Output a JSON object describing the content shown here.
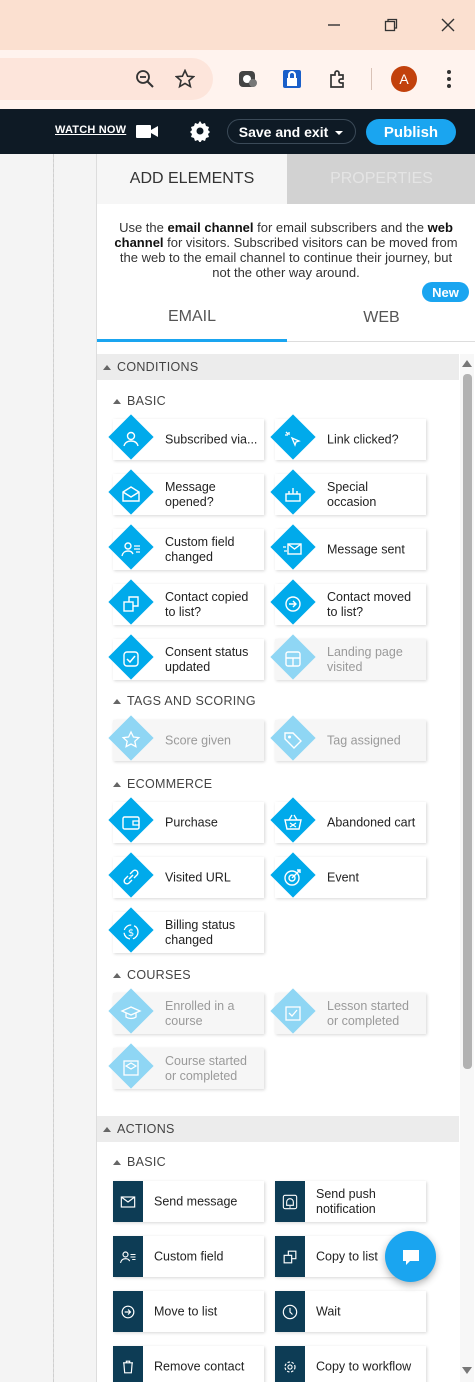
{
  "app_header": {
    "watch_now": "WATCH NOW",
    "save_exit": "Save and exit",
    "publish": "Publish"
  },
  "browser": {
    "avatar_letter": "A"
  },
  "panel": {
    "tab_add": "ADD ELEMENTS",
    "tab_properties": "PROPERTIES",
    "intro_parts": [
      "Use the ",
      "email channel",
      " for email subscribers and the ",
      "web channel",
      " for visitors. Subscribed visitors can be moved from the web to the email channel to continue their journey, but not the other way around."
    ],
    "channel_email": "EMAIL",
    "channel_web": "WEB",
    "new_badge": "New"
  },
  "conditions": {
    "header": "CONDITIONS",
    "basic_label": "BASIC",
    "basic": [
      {
        "label": "Subscribed via...",
        "icon": "user-icon",
        "enabled": true
      },
      {
        "label": "Link clicked?",
        "icon": "cursor-click-icon",
        "enabled": true
      },
      {
        "label": "Message opened?",
        "icon": "envelope-open-icon",
        "enabled": true
      },
      {
        "label": "Special occasion",
        "icon": "cake-icon",
        "enabled": true
      },
      {
        "label": "Custom field changed",
        "icon": "user-lines-icon",
        "enabled": true
      },
      {
        "label": "Message sent",
        "icon": "envelope-sent-icon",
        "enabled": true
      },
      {
        "label": "Contact copied to list?",
        "icon": "copy-icon",
        "enabled": true
      },
      {
        "label": "Contact moved to list?",
        "icon": "arrow-circle-icon",
        "enabled": true
      },
      {
        "label": "Consent status updated",
        "icon": "checkbox-icon",
        "enabled": true
      },
      {
        "label": "Landing page visited",
        "icon": "layout-icon",
        "enabled": false
      }
    ],
    "tags_label": "TAGS AND SCORING",
    "tags": [
      {
        "label": "Score given",
        "icon": "star-icon",
        "enabled": false
      },
      {
        "label": "Tag assigned",
        "icon": "tag-icon",
        "enabled": false
      }
    ],
    "ecommerce_label": "ECOMMERCE",
    "ecommerce": [
      {
        "label": "Purchase",
        "icon": "wallet-icon",
        "enabled": true
      },
      {
        "label": "Abandoned cart",
        "icon": "basket-icon",
        "enabled": true
      },
      {
        "label": "Visited URL",
        "icon": "link-icon",
        "enabled": true
      },
      {
        "label": "Event",
        "icon": "target-icon",
        "enabled": true
      },
      {
        "label": "Billing status changed",
        "icon": "dollar-cycle-icon",
        "enabled": true
      }
    ],
    "courses_label": "COURSES",
    "courses": [
      {
        "label": "Enrolled in a course",
        "icon": "grad-cap-icon",
        "enabled": false
      },
      {
        "label": "Lesson started or completed",
        "icon": "lesson-icon",
        "enabled": false
      },
      {
        "label": "Course started or completed",
        "icon": "course-icon",
        "enabled": false
      }
    ]
  },
  "actions": {
    "header": "ACTIONS",
    "basic_label": "BASIC",
    "basic": [
      {
        "label": "Send message",
        "icon": "envelope-icon"
      },
      {
        "label": "Send push notification",
        "icon": "bell-icon"
      },
      {
        "label": "Custom field",
        "icon": "user-lines-icon"
      },
      {
        "label": "Copy to list",
        "icon": "copy-icon"
      },
      {
        "label": "Move to list",
        "icon": "arrow-circle-icon"
      },
      {
        "label": "Wait",
        "icon": "clock-icon"
      },
      {
        "label": "Remove contact",
        "icon": "trash-icon"
      },
      {
        "label": "Copy to workflow",
        "icon": "gear-copy-icon"
      }
    ]
  },
  "colors": {
    "accent": "#1aa5f0",
    "condition_diamond": "#00aaeb",
    "condition_diamond_disabled": "#8fd6f4",
    "action_square": "#0d3c55",
    "header_bg": "#0e1a25"
  }
}
